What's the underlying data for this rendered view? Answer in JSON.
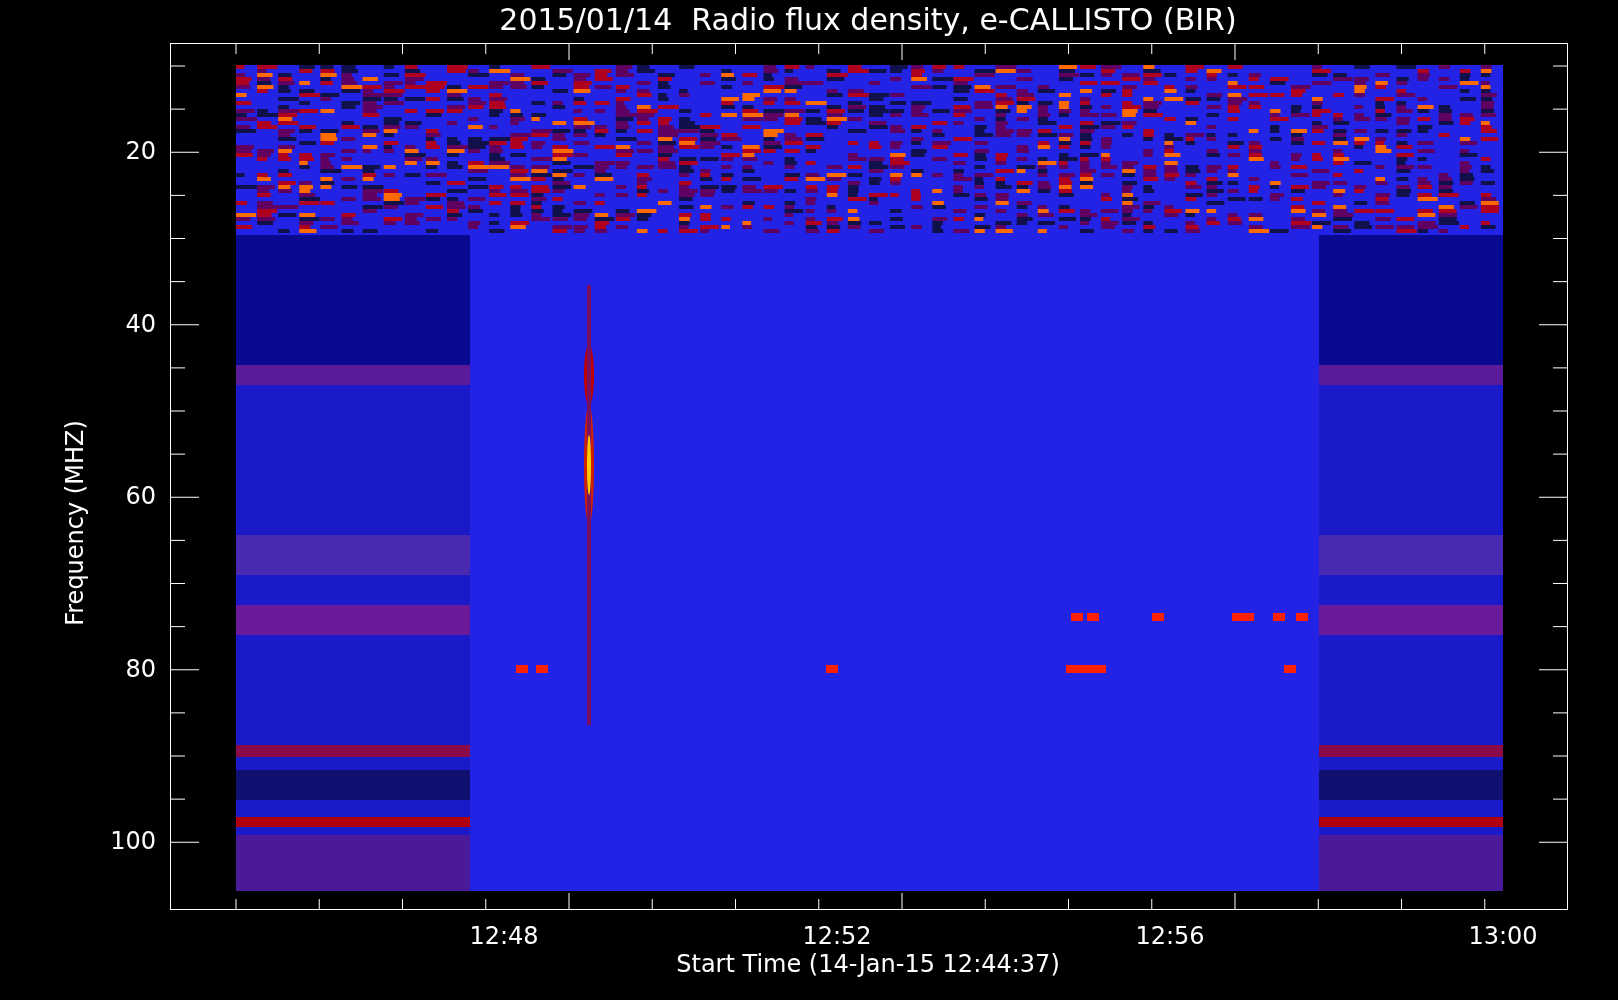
{
  "plot": {
    "title": "2015/01/14  Radio flux density, e-CALLISTO (BIR)",
    "ylabel": "Frequency (MHZ)",
    "xlabel": "Start Time (14-Jan-15 12:44:37)",
    "yticks": [
      "20",
      "40",
      "60",
      "80",
      "100"
    ],
    "xticks": [
      "12:48",
      "12:52",
      "12:56",
      "13:00"
    ]
  }
}
